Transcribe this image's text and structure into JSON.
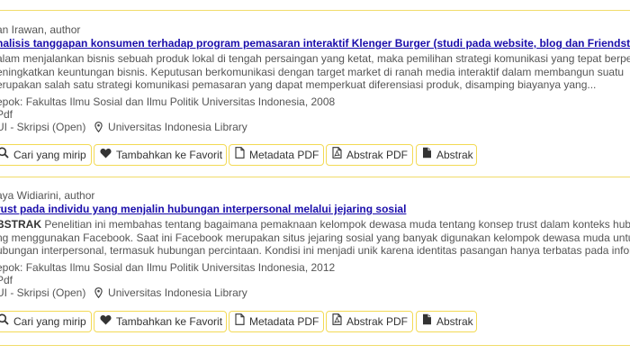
{
  "records": [
    {
      "author": "an Irawan, author",
      "title": "nalisis tanggapan konsumen terhadap program pemasaran interaktif Klenger Burger (studi pada website, blog dan Friendster)",
      "abstract_label": "",
      "abstract_lines": [
        "alam menjalankan bisnis sebuah produk lokal di tengah persaingan yang ketat, maka pemilihan strategi komunikasi yang tepat berperan",
        "eningkatkan keuntungan bisnis. Keputusan berkomunikasi dengan target market di ranah media interaktif dalam membangun suatu",
        "erupakan salah satu strategi komunikasi pemasaran yang dapat memperkuat diferensiasi produk, disamping biayanya yang..."
      ],
      "publisher": "epok: Fakultas Ilmu Sosial dan Ilmu Politik Universitas Indonesia, 2008",
      "format": "Pdf",
      "collection": "UI - Skripsi (Open)",
      "library": "Universitas Indonesia Library"
    },
    {
      "author": "aya Widiarini, author",
      "title": "rust pada individu yang menjalin hubungan interpersonal melalui jejaring sosial",
      "abstract_label": "BSTRAK",
      "abstract_lines": [
        " Penelitian ini membahas tentang bagaimana pemaknaan kelompok dewasa muda tentang konsep trust dalam konteks hubungan",
        "ng menggunakan Facebook. Saat ini Facebook merupakan situs jejaring sosial yang banyak digunakan kelompok dewasa muda untuk",
        "ubungan interpersonal, termasuk hubungan percintaan. Kondisi ini menjadi unik karena identitas pasangan hanya terbatas pada informasi"
      ],
      "publisher": "epok: Fakultas Ilmu Sosial dan Ilmu Politik Universitas Indonesia, 2012",
      "format": "Pdf",
      "collection": "UI - Skripsi (Open)",
      "library": "Universitas Indonesia Library"
    }
  ],
  "actions": {
    "similar": "Cari yang mirip",
    "favorite": "Tambahkan ke Favorit",
    "metadata": "Metadata PDF",
    "abstract_pdf": "Abstrak PDF",
    "abstract": "Abstrak"
  },
  "colors": {
    "border": "#f1dc6b",
    "title_link": "#1a0dab"
  },
  "icons": [
    "search-icon",
    "heart-icon",
    "file-icon",
    "pdf-file-icon",
    "document-icon",
    "map-pin-icon"
  ]
}
